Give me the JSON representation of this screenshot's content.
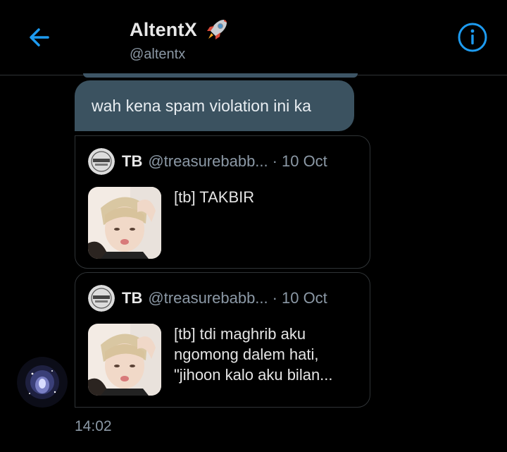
{
  "header": {
    "title": "AltentX",
    "handle": "@altentx",
    "back_icon": "arrow-left-icon",
    "info_icon": "info-icon",
    "title_emoji": "rocket-icon",
    "accent": "#1d9bf0"
  },
  "messages": {
    "bubble_text": "wah kena spam violation ini ka",
    "bubble_color": "#3b5260",
    "quotes": [
      {
        "name": "TB",
        "handle": "@treasurebabb...",
        "separator": "·",
        "date": "10 Oct",
        "lines": [
          "[tb] TAKBIR"
        ]
      },
      {
        "name": "TB",
        "handle": "@treasurebabb...",
        "separator": "·",
        "date": "10 Oct",
        "lines": [
          "[tb] tdi maghrib aku",
          "ngomong dalem hati,",
          "\"jihoon kalo aku bilan..."
        ]
      }
    ],
    "timestamp": "14:02"
  }
}
